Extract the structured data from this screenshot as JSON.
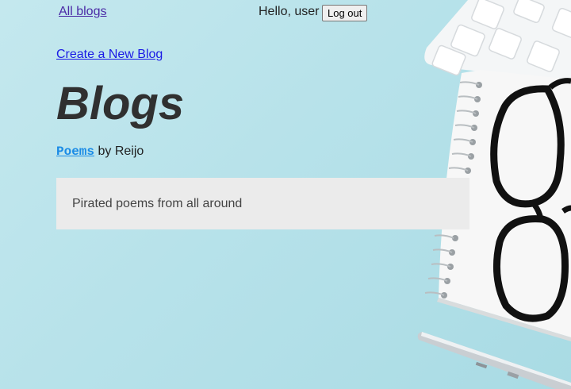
{
  "nav": {
    "all_blogs": "All blogs",
    "greeting": "Hello, user",
    "logout": "Log out"
  },
  "main": {
    "create_link": "Create a New Blog",
    "title": "Blogs",
    "blogs": [
      {
        "title": "Poems",
        "by": "by Reijo",
        "description": "Pirated poems from all around"
      }
    ]
  },
  "colors": {
    "background": "#b7e2ea",
    "card": "#ebebeb",
    "blog_link": "#1a8be6",
    "nav_link": "#4b2aa6"
  }
}
